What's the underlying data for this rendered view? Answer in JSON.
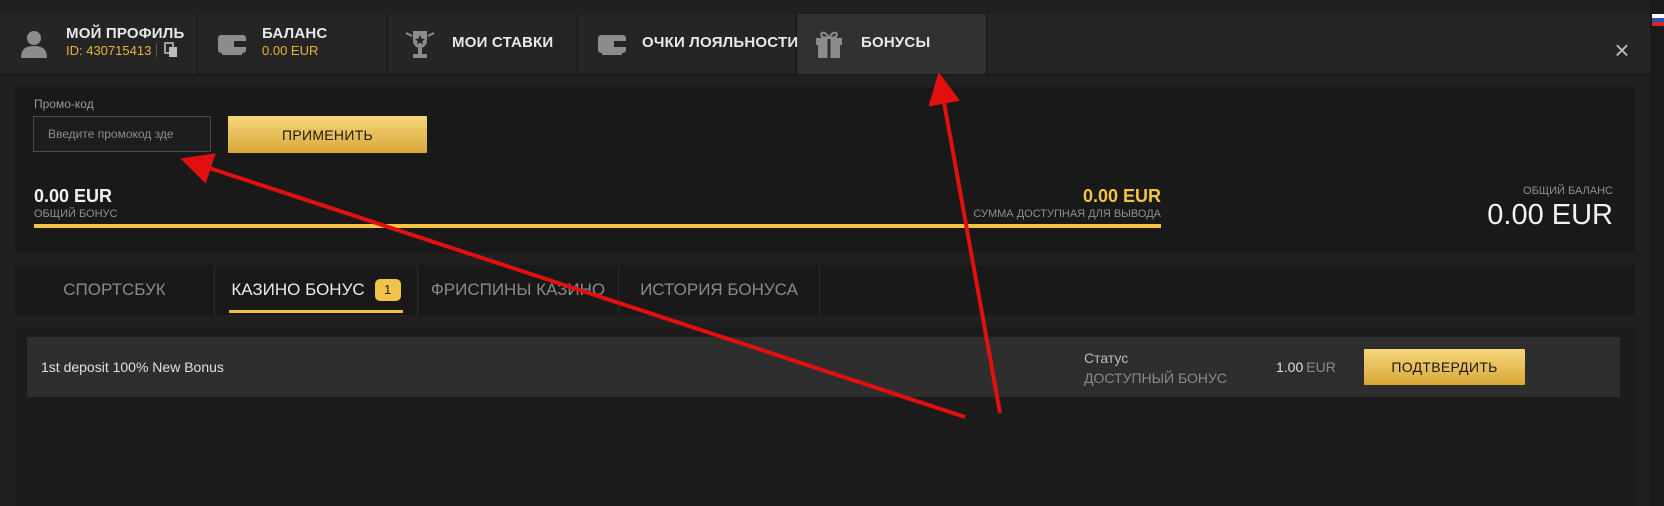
{
  "header": {
    "tabs": [
      {
        "label": "МОЙ ПРОФИЛЬ",
        "sub": "ID: 430715413",
        "icon": "user-icon"
      },
      {
        "label": "БАЛАНС",
        "sub": "0.00 EUR",
        "icon": "wallet-icon"
      },
      {
        "label": "МОИ СТАВКИ",
        "icon": "trophy-icon"
      },
      {
        "label": "ОЧКИ ЛОЯЛЬНОСТИ",
        "icon": "wallet-icon"
      },
      {
        "label": "БОНУСЫ",
        "icon": "gift-icon",
        "active": true
      }
    ],
    "close": "×"
  },
  "promo": {
    "label": "Промо-код",
    "placeholder": "Введите промокод зде",
    "apply": "ПРИМЕНИТЬ"
  },
  "balance": {
    "total_bonus_amount": "0.00 EUR",
    "total_bonus_label": "ОБЩИЙ БОНУС",
    "withdrawable_amount": "0.00 EUR",
    "withdrawable_label": "СУММА ДОСТУПНАЯ ДЛЯ ВЫВОДА",
    "overall_label": "ОБЩИЙ БАЛАНС",
    "overall_amount": "0.00 EUR"
  },
  "subtabs": [
    {
      "label": "СПОРТСБУК"
    },
    {
      "label": "КАЗИНО БОНУС",
      "badge": "1",
      "active": true
    },
    {
      "label": "ФРИСПИНЫ КАЗИНО"
    },
    {
      "label": "ИСТОРИЯ БОНУСА"
    }
  ],
  "bonuses": [
    {
      "title": "1st deposit 100% New Bonus",
      "status_label": "Статус",
      "status_value": "ДОСТУПНЫЙ БОНУС",
      "amount": "1.00",
      "currency": "EUR",
      "action": "ПОДТВЕРДИТЬ"
    }
  ],
  "colors": {
    "accent": "#f5c342",
    "annotation_arrow": "#e01010",
    "background": "#202020"
  }
}
